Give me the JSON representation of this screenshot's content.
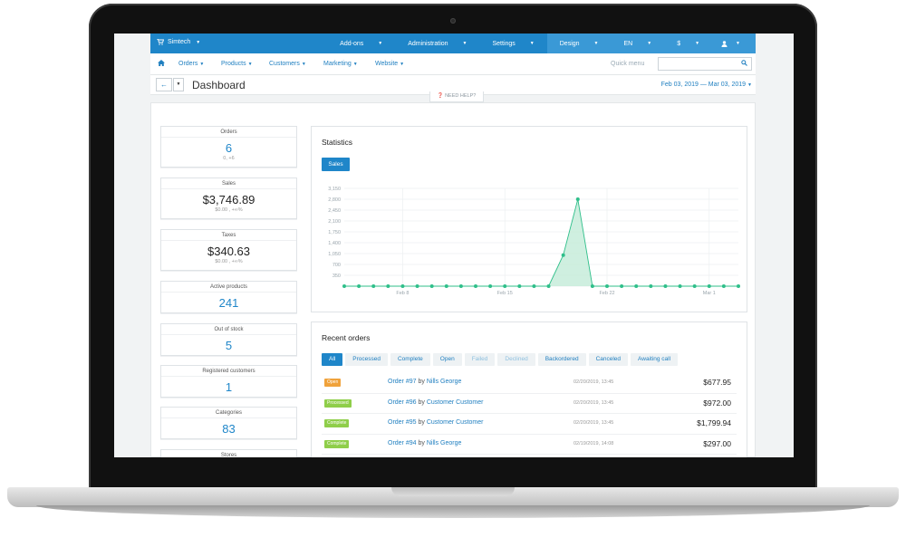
{
  "topbar": {
    "brand": "Simtech",
    "menus": [
      {
        "label": "Add-ons"
      },
      {
        "label": "Administration"
      },
      {
        "label": "Settings"
      },
      {
        "label": "Design"
      },
      {
        "label": "EN"
      },
      {
        "label": "$"
      }
    ]
  },
  "navbar": {
    "items": [
      {
        "label": "Orders"
      },
      {
        "label": "Products"
      },
      {
        "label": "Customers"
      },
      {
        "label": "Marketing"
      },
      {
        "label": "Website"
      }
    ],
    "quick_menu": "Quick menu"
  },
  "header": {
    "title": "Dashboard",
    "date_range": "Feb 03, 2019 — Mar 03, 2019",
    "need_help": "NEED HELP?"
  },
  "stats": [
    {
      "label": "Orders",
      "value": "6",
      "sub": "0, +6",
      "style": "blue"
    },
    {
      "label": "Sales",
      "value": "$3,746.89",
      "sub": "$0.00 , +∞%",
      "style": "dark"
    },
    {
      "label": "Taxes",
      "value": "$340.63",
      "sub": "$0.00 , +∞%",
      "style": "dark"
    },
    {
      "label": "Active products",
      "value": "241",
      "sub": "",
      "style": "blue"
    },
    {
      "label": "Out of stock",
      "value": "5",
      "sub": "",
      "style": "blue"
    },
    {
      "label": "Registered customers",
      "value": "1",
      "sub": "",
      "style": "blue"
    },
    {
      "label": "Categories",
      "value": "83",
      "sub": "",
      "style": "blue"
    },
    {
      "label": "Stores",
      "value": "",
      "sub": "",
      "style": "blue"
    }
  ],
  "statistics": {
    "title": "Statistics",
    "button": "Sales"
  },
  "chart_data": {
    "type": "area",
    "y_ticks": [
      "3,150",
      "2,800",
      "2,450",
      "2,100",
      "1,750",
      "1,400",
      "1,050",
      "700",
      "350"
    ],
    "ylim": [
      0,
      3150
    ],
    "x_ticks": [
      "Feb 8",
      "Feb 15",
      "Feb 22",
      "Mar 1"
    ],
    "grid": true,
    "colors": {
      "line": "#2fbf8a",
      "fill": "#bfe9d6"
    },
    "series": [
      {
        "values": [
          0,
          0,
          0,
          0,
          0,
          0,
          0,
          0,
          0,
          0,
          0,
          0,
          0,
          0,
          0,
          1000,
          2800,
          0,
          0,
          0,
          0,
          0,
          0,
          0,
          0,
          0,
          0,
          0
        ]
      }
    ]
  },
  "orders": {
    "title": "Recent orders",
    "tabs": [
      {
        "label": "All",
        "state": "active"
      },
      {
        "label": "Processed",
        "state": "normal"
      },
      {
        "label": "Complete",
        "state": "normal"
      },
      {
        "label": "Open",
        "state": "normal"
      },
      {
        "label": "Failed",
        "state": "muted"
      },
      {
        "label": "Declined",
        "state": "muted"
      },
      {
        "label": "Backordered",
        "state": "normal"
      },
      {
        "label": "Canceled",
        "state": "normal"
      },
      {
        "label": "Awaiting call",
        "state": "normal"
      }
    ],
    "rows": [
      {
        "status": "Open",
        "status_color": "#f0a23b",
        "order": "Order #97",
        "by": "by",
        "customer": "Nills George",
        "date": "02/20/2019, 13:45",
        "total": "$677.95"
      },
      {
        "status": "Processed",
        "status_color": "#8fce4a",
        "order": "Order #96",
        "by": "by",
        "customer": "Customer Customer",
        "date": "02/20/2019, 13:45",
        "total": "$972.00"
      },
      {
        "status": "Complete",
        "status_color": "#8fce4a",
        "order": "Order #95",
        "by": "by",
        "customer": "Customer Customer",
        "date": "02/20/2019, 13:45",
        "total": "$1,799.94"
      },
      {
        "status": "Complete",
        "status_color": "#8fce4a",
        "order": "Order #94",
        "by": "by",
        "customer": "Nills George",
        "date": "02/19/2019, 14:08",
        "total": "$297.00"
      }
    ]
  }
}
